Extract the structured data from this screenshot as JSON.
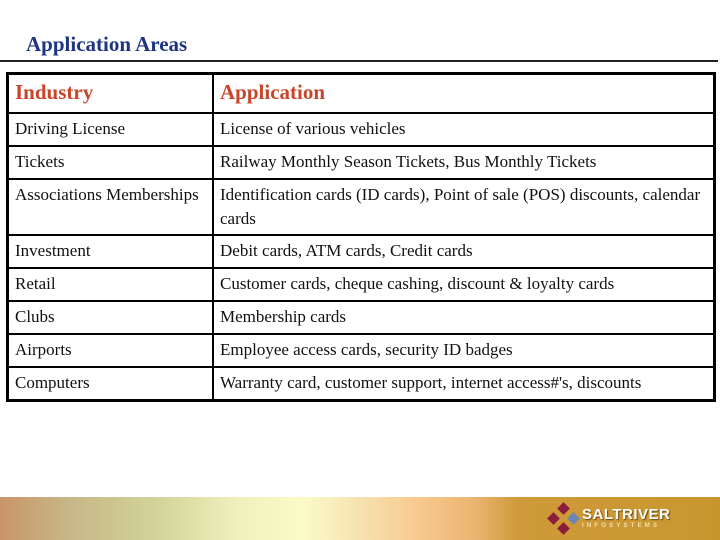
{
  "title": "Application Areas",
  "table": {
    "headers": [
      "Industry",
      "Application"
    ],
    "rows": [
      [
        "Driving License",
        "License of various vehicles"
      ],
      [
        "Tickets",
        "Railway Monthly Season Tickets, Bus Monthly Tickets"
      ],
      [
        "Associations Memberships",
        "Identification cards (ID cards), Point of sale (POS) discounts, calendar cards"
      ],
      [
        "Investment",
        "Debit cards, ATM cards, Credit cards"
      ],
      [
        "Retail",
        "Customer cards, cheque cashing, discount & loyalty cards"
      ],
      [
        "Clubs",
        "Membership cards"
      ],
      [
        "Airports",
        "Employee access cards, security ID badges"
      ],
      [
        "Computers",
        "Warranty card, customer support, internet access#'s, discounts"
      ]
    ]
  },
  "footer": {
    "logo_name": "SALTRIVER",
    "logo_sub": "INFOSYSTEMS"
  },
  "colors": {
    "title": "#1f3582",
    "header_text": "#c8452a",
    "footer_accent": "#c9962e"
  }
}
